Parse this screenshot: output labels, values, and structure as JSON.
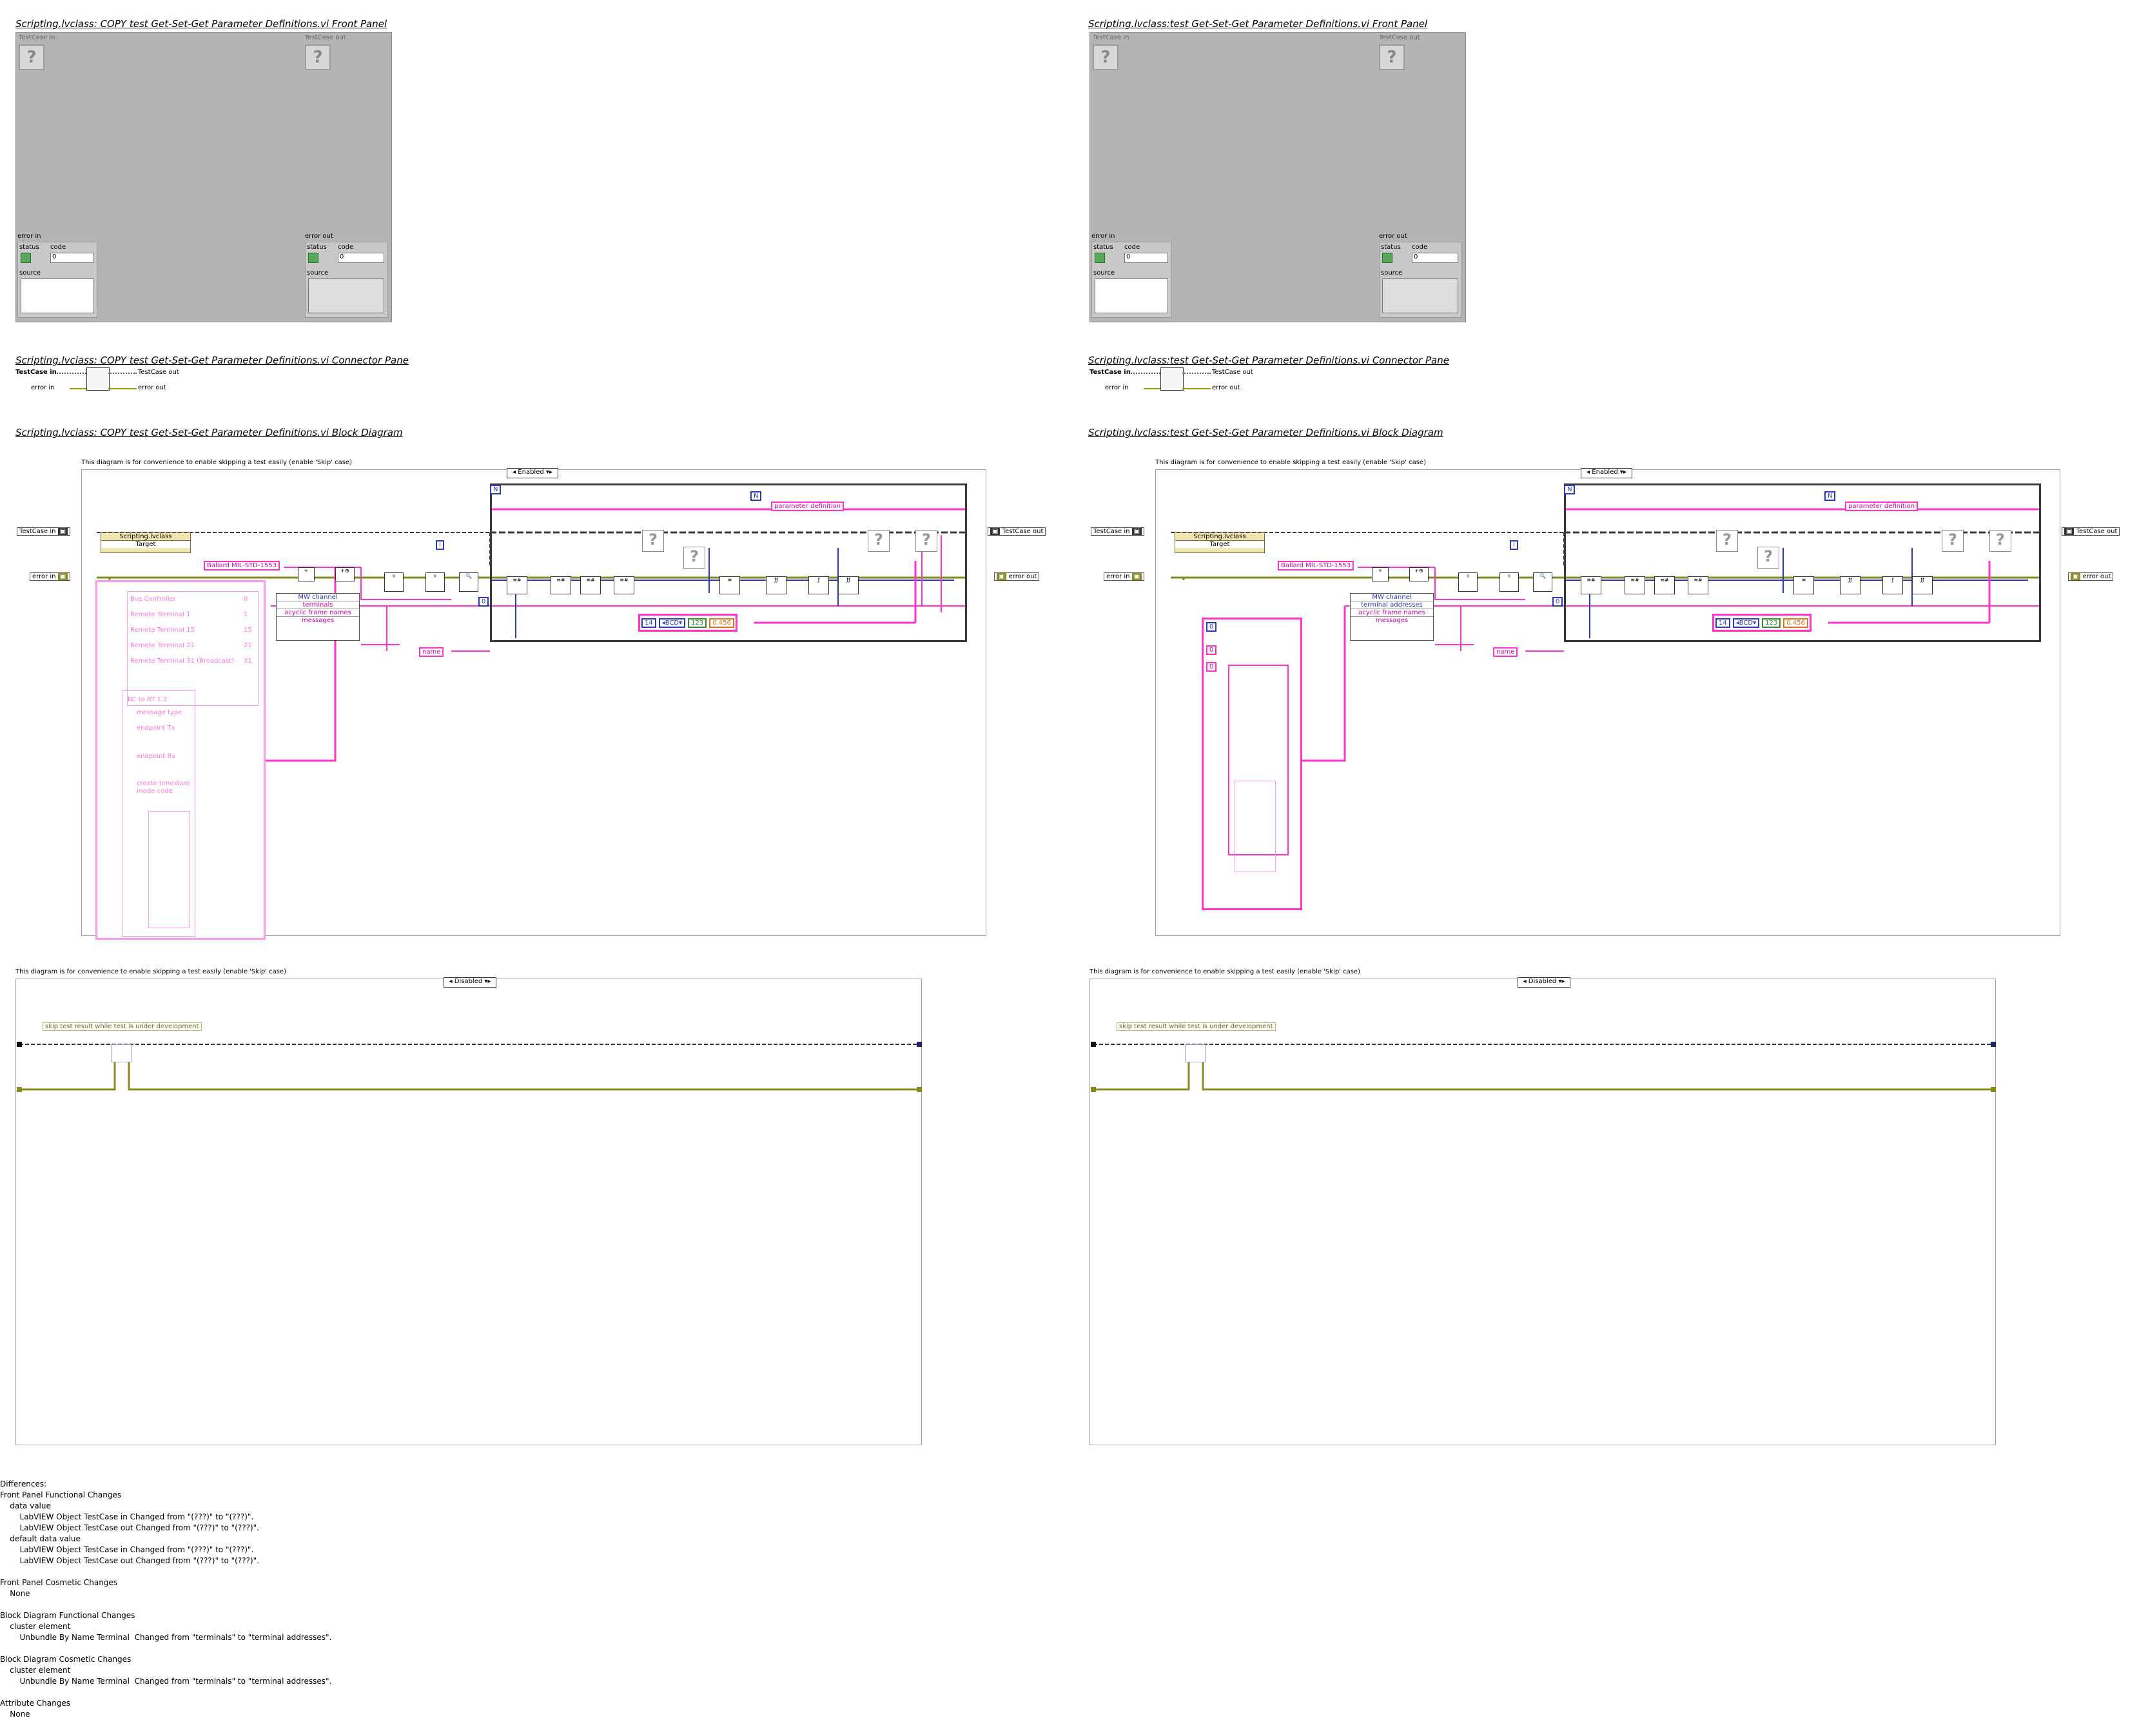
{
  "left": {
    "fp_title": "Scripting.lvclass:  COPY  test Get-Set-Get Parameter Definitions.vi Front Panel",
    "cp_title": "Scripting.lvclass:  COPY  test Get-Set-Get Parameter Definitions.vi Connector Pane",
    "bd_title": "Scripting.lvclass:  COPY  test Get-Set-Get Parameter Definitions.vi Block Diagram",
    "unbundle_items": [
      "MW channel",
      "terminals",
      "acyclic frame names",
      "messages"
    ],
    "list_items": [
      "Bus Controller",
      "Remote Terminal 1",
      "Remote Terminal 15",
      "Remote Terminal 21",
      "Remote Terminal 31 (Broadcast)"
    ],
    "list_values": [
      "0",
      "1",
      "15",
      "21",
      "31"
    ],
    "msg_labels": [
      "BC to RT 1.2",
      "message type",
      "endpoint Tx",
      "endpoint Rx",
      "create timestam",
      "mode code"
    ]
  },
  "right": {
    "fp_title": "Scripting.lvclass:test Get-Set-Get Parameter Definitions.vi Front Panel",
    "cp_title": "Scripting.lvclass:test Get-Set-Get Parameter Definitions.vi Connector Pane",
    "bd_title": "Scripting.lvclass:test Get-Set-Get Parameter Definitions.vi Block Diagram",
    "unbundle_items": [
      "MW channel",
      "terminal addresses",
      "acyclic frame names",
      "messages"
    ]
  },
  "fp": {
    "testcase_in": "TestCase in",
    "testcase_out": "TestCase out",
    "error_in": "error in",
    "error_out": "error out",
    "status": "status",
    "code": "code",
    "source": "source",
    "code_value": "0"
  },
  "cp": {
    "testcase_in": "TestCase in",
    "testcase_out": "TestCase out",
    "error_in": "error in",
    "error_out": "error out"
  },
  "bd": {
    "comment": "This diagram is for convenience to enable skipping a test easily (enable 'Skip' case)",
    "enabled_label": "Enabled",
    "testcase_in": "TestCase in",
    "testcase_out": "TestCase out",
    "error_in": "error in",
    "error_out": "error out",
    "class_node": "Scripting.lvclass",
    "target": "Target",
    "ballard": "Ballard MIL-STD-1553",
    "param_def": "parameter definition",
    "name": "name",
    "const_n": "N",
    "const_i": "i",
    "const_zero": "0",
    "const_14": "14",
    "bcd": "BCD",
    "const_123": "123",
    "const_0456": "0.456"
  },
  "second": {
    "comment": "This diagram is for convenience to enable skipping a test easily (enable 'Skip' case)",
    "disabled_label": "Disabled",
    "skip_note": "skip test result while test is under development"
  },
  "differences": {
    "title": "Differences:",
    "lines": [
      "Front Panel Functional Changes",
      "    data value",
      "        LabVIEW Object TestCase in Changed from \"(???)\" to \"(???)\".",
      "        LabVIEW Object TestCase out Changed from \"(???)\" to \"(???)\".",
      "    default data value",
      "        LabVIEW Object TestCase in Changed from \"(???)\" to \"(???)\".",
      "        LabVIEW Object TestCase out Changed from \"(???)\" to \"(???)\".",
      "",
      "Front Panel Cosmetic Changes",
      "    None",
      "",
      "Block Diagram Functional Changes",
      "    cluster element",
      "        Unbundle By Name Terminal  Changed from \"terminals\" to \"terminal addresses\".",
      "",
      "Block Diagram Cosmetic Changes",
      "    cluster element",
      "        Unbundle By Name Terminal  Changed from \"terminals\" to \"terminal addresses\".",
      "",
      "Attribute Changes",
      "    None"
    ]
  },
  "colors": {
    "panel_grey": "#b4b4b4",
    "wire_pink": "#ff33cc",
    "wire_blue": "#2b3ab8",
    "wire_olive": "#8a8a20",
    "frame_dark": "#3a3a3a"
  }
}
